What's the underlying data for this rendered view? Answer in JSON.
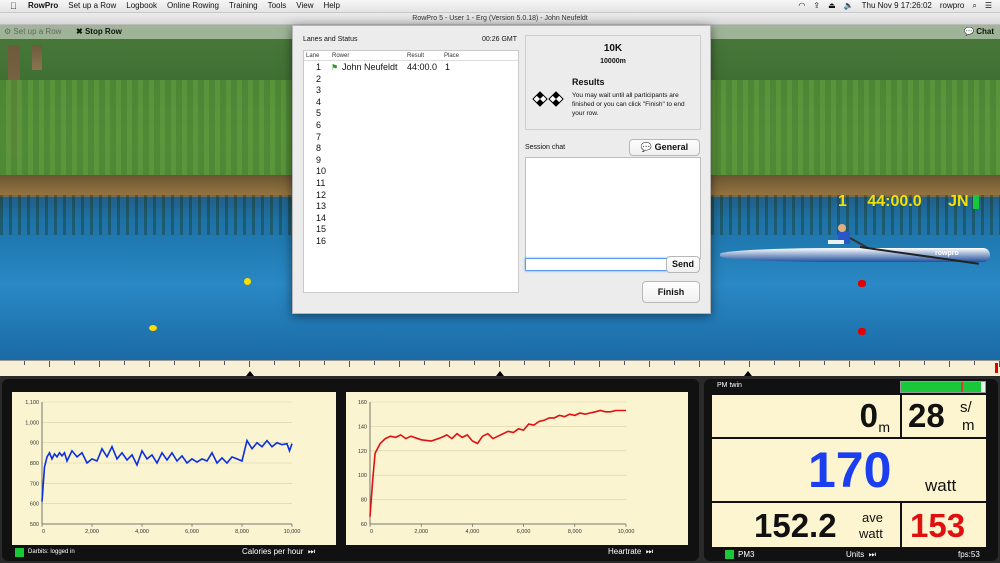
{
  "menubar": {
    "app": "RowPro",
    "menus": [
      "Set up a Row",
      "Logbook",
      "Online Rowing",
      "Training",
      "Tools",
      "View",
      "Help"
    ],
    "clock": "Thu Nov 9  17:26:02",
    "user": "rowpro"
  },
  "window": {
    "title": "RowPro 5 - User 1 - Erg  (Version 5.0.18)  - John Neufeldt"
  },
  "toolbar": {
    "setup_label": "Set up a Row",
    "stop_label": "Stop Row",
    "chat_label": "Chat"
  },
  "scene": {
    "lane": "1",
    "time": "44:00.0",
    "initials": "JN"
  },
  "dialog": {
    "lanes_title": "Lanes and Status",
    "clock": "00:26 GMT",
    "headers": {
      "lane": "Lane",
      "rower": "Rower",
      "result": "Result",
      "place": "Place"
    },
    "rows": [
      {
        "lane": "1",
        "rower": "John Neufeldt",
        "result": "44:00.0",
        "place": "1"
      },
      {
        "lane": "2",
        "rower": "",
        "result": "",
        "place": ""
      },
      {
        "lane": "3",
        "rower": "",
        "result": "",
        "place": ""
      },
      {
        "lane": "4",
        "rower": "",
        "result": "",
        "place": ""
      },
      {
        "lane": "5",
        "rower": "",
        "result": "",
        "place": ""
      },
      {
        "lane": "6",
        "rower": "",
        "result": "",
        "place": ""
      },
      {
        "lane": "7",
        "rower": "",
        "result": "",
        "place": ""
      },
      {
        "lane": "8",
        "rower": "",
        "result": "",
        "place": ""
      },
      {
        "lane": "9",
        "rower": "",
        "result": "",
        "place": ""
      },
      {
        "lane": "10",
        "rower": "",
        "result": "",
        "place": ""
      },
      {
        "lane": "11",
        "rower": "",
        "result": "",
        "place": ""
      },
      {
        "lane": "12",
        "rower": "",
        "result": "",
        "place": ""
      },
      {
        "lane": "13",
        "rower": "",
        "result": "",
        "place": ""
      },
      {
        "lane": "14",
        "rower": "",
        "result": "",
        "place": ""
      },
      {
        "lane": "15",
        "rower": "",
        "result": "",
        "place": ""
      },
      {
        "lane": "16",
        "rower": "",
        "result": "",
        "place": ""
      }
    ],
    "race_name": "10K",
    "race_distance": "10000m",
    "results_title": "Results",
    "results_text": "You may wait until all participants are finished or you can click \"Finish\" to end your row.",
    "session_chat_label": "Session chat",
    "general_chat_label": "General Chat",
    "chat_input_value": "",
    "send_label": "Send",
    "finish_label": "Finish"
  },
  "chart_data": [
    {
      "type": "line",
      "title": "",
      "xlabel": "Calories per hour",
      "ylabel": "",
      "xlim": [
        0,
        10000
      ],
      "ylim": [
        500,
        1100
      ],
      "yticks": [
        "1,100",
        "1,000",
        "900",
        "800",
        "700",
        "600",
        "500"
      ],
      "xticks": [
        "0",
        "2,000",
        "4,000",
        "6,000",
        "8,000",
        "10,000"
      ],
      "color": "#0a2ee0",
      "series": [
        {
          "x": [
            0,
            100,
            200,
            300,
            400,
            500,
            600,
            700,
            800,
            900,
            1000,
            1200,
            1400,
            1600,
            1800,
            2000,
            2200,
            2400,
            2600,
            2800,
            3000,
            3200,
            3400,
            3600,
            3800,
            4000,
            4200,
            4400,
            4600,
            4800,
            5000,
            5200,
            5400,
            5600,
            5800,
            6000,
            6200,
            6400,
            6600,
            6800,
            7000,
            7200,
            7400,
            7600,
            7800,
            8000,
            8200,
            8400,
            8600,
            8800,
            9000,
            9200,
            9400,
            9600,
            9800,
            9900,
            10000
          ],
          "y": [
            610,
            780,
            830,
            850,
            820,
            845,
            830,
            850,
            835,
            850,
            810,
            860,
            830,
            850,
            800,
            820,
            810,
            870,
            830,
            880,
            820,
            850,
            815,
            840,
            790,
            860,
            820,
            840,
            800,
            850,
            815,
            850,
            810,
            835,
            800,
            820,
            805,
            820,
            810,
            850,
            800,
            825,
            800,
            830,
            820,
            810,
            910,
            870,
            900,
            880,
            910,
            880,
            900,
            890,
            895,
            860,
            895
          ]
        }
      ]
    },
    {
      "type": "line",
      "title": "",
      "xlabel": "Heartrate",
      "ylabel": "",
      "xlim": [
        0,
        10000
      ],
      "ylim": [
        60,
        160
      ],
      "yticks": [
        "160",
        "140",
        "120",
        "100",
        "80",
        "60"
      ],
      "xticks": [
        "0",
        "2,000",
        "4,000",
        "6,000",
        "8,000",
        "10,000"
      ],
      "color": "#e01010",
      "series": [
        {
          "x": [
            0,
            100,
            200,
            400,
            600,
            800,
            1000,
            1200,
            1400,
            1600,
            2000,
            2400,
            2800,
            3000,
            3200,
            3400,
            3600,
            3800,
            4000,
            4200,
            4400,
            4600,
            4800,
            5000,
            5200,
            5400,
            5600,
            5800,
            6000,
            6200,
            6400,
            6600,
            6800,
            7000,
            7200,
            7400,
            7600,
            7800,
            8000,
            8200,
            8400,
            8600,
            8800,
            9000,
            9200,
            9400,
            9600,
            9800,
            10000
          ],
          "y": [
            66,
            95,
            118,
            126,
            130,
            132,
            131,
            133,
            130,
            132,
            129,
            128,
            131,
            133,
            130,
            134,
            131,
            133,
            128,
            126,
            132,
            134,
            130,
            132,
            134,
            136,
            135,
            138,
            137,
            142,
            141,
            144,
            145,
            147,
            147,
            149,
            148,
            150,
            149,
            151,
            150,
            151,
            152,
            153,
            152,
            152,
            153,
            153,
            153
          ]
        }
      ]
    }
  ],
  "charts": {
    "status_text": "Darbits: logged in",
    "calories_label": "Calories per hour",
    "heartrate_label": "Heartrate"
  },
  "pm": {
    "title": "PM twin",
    "distance": "0",
    "distance_unit": "m",
    "rate": "28",
    "rate_unit_top": "s/",
    "rate_unit_bottom": "m",
    "watts": "170",
    "watts_unit": "watt",
    "avg_watts": "152.2",
    "avg_unit_top": "ave",
    "avg_unit_bottom": "watt",
    "heartrate": "153",
    "device": "PM3",
    "units_label": "Units",
    "fps": "fps:53",
    "progress": 0.95,
    "colors": {
      "watts": "#1a3ef0",
      "heartrate": "#e01010",
      "progress": "#18c838"
    }
  }
}
